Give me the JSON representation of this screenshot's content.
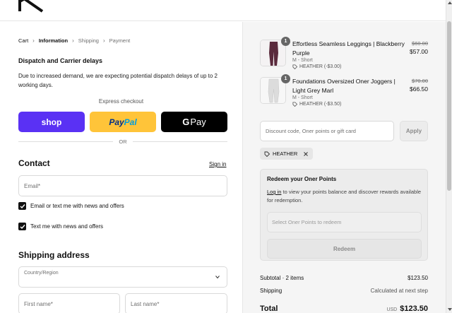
{
  "breadcrumb": {
    "cart": "Cart",
    "information": "Information",
    "shipping": "Shipping",
    "payment": "Payment"
  },
  "notice": {
    "title": "Dispatch and Carrier delays",
    "text": "Due to increased demand, we are expecting potential dispatch delays of up to 2 working days."
  },
  "express": {
    "label": "Express checkout",
    "shop_label": "shop",
    "paypal_part1": "Pay",
    "paypal_part2": "Pal",
    "gpay_g": "G",
    "gpay_label": "Pay",
    "or_label": "OR"
  },
  "contact": {
    "title": "Contact",
    "signin": "Sign in",
    "email_placeholder": "Email*",
    "news_email": "Email or text me with news and offers",
    "news_text": "Text me with news and offers"
  },
  "shipping": {
    "title": "Shipping address",
    "country_label": "Country/Region",
    "first_name": "First name*",
    "last_name": "Last name*"
  },
  "cart": {
    "items": [
      {
        "quantity": "1",
        "name": "Effortless Seamless Leggings | Blackberry Purple",
        "variant": "M - Short",
        "discount": "HEATHER (-$3.00)",
        "was_price": "$60.00",
        "price": "$57.00",
        "color": "#5a2a3c"
      },
      {
        "quantity": "1",
        "name": "Foundations Oversized Oner Joggers | Light Grey Marl",
        "variant": "M - Short",
        "discount": "HEATHER (-$3.50)",
        "was_price": "$70.00",
        "price": "$66.50",
        "color": "#d8d8d8"
      }
    ],
    "discount_placeholder": "Discount code, Oner points or gift card",
    "apply_label": "Apply",
    "applied_code": "HEATHER"
  },
  "redeem": {
    "title": "Redeem your Oner Points",
    "login_link": "Log in",
    "text": "to view your points balance and discover rewards available for redemption.",
    "select_placeholder": "Select Oner Points to redeem",
    "button": "Redeem"
  },
  "summary": {
    "subtotal_label": "Subtotal · 2 items",
    "subtotal_value": "$123.50",
    "shipping_label": "Shipping",
    "shipping_value": "Calculated at next step",
    "total_label": "Total",
    "total_currency": "USD",
    "total_value": "$123.50"
  }
}
